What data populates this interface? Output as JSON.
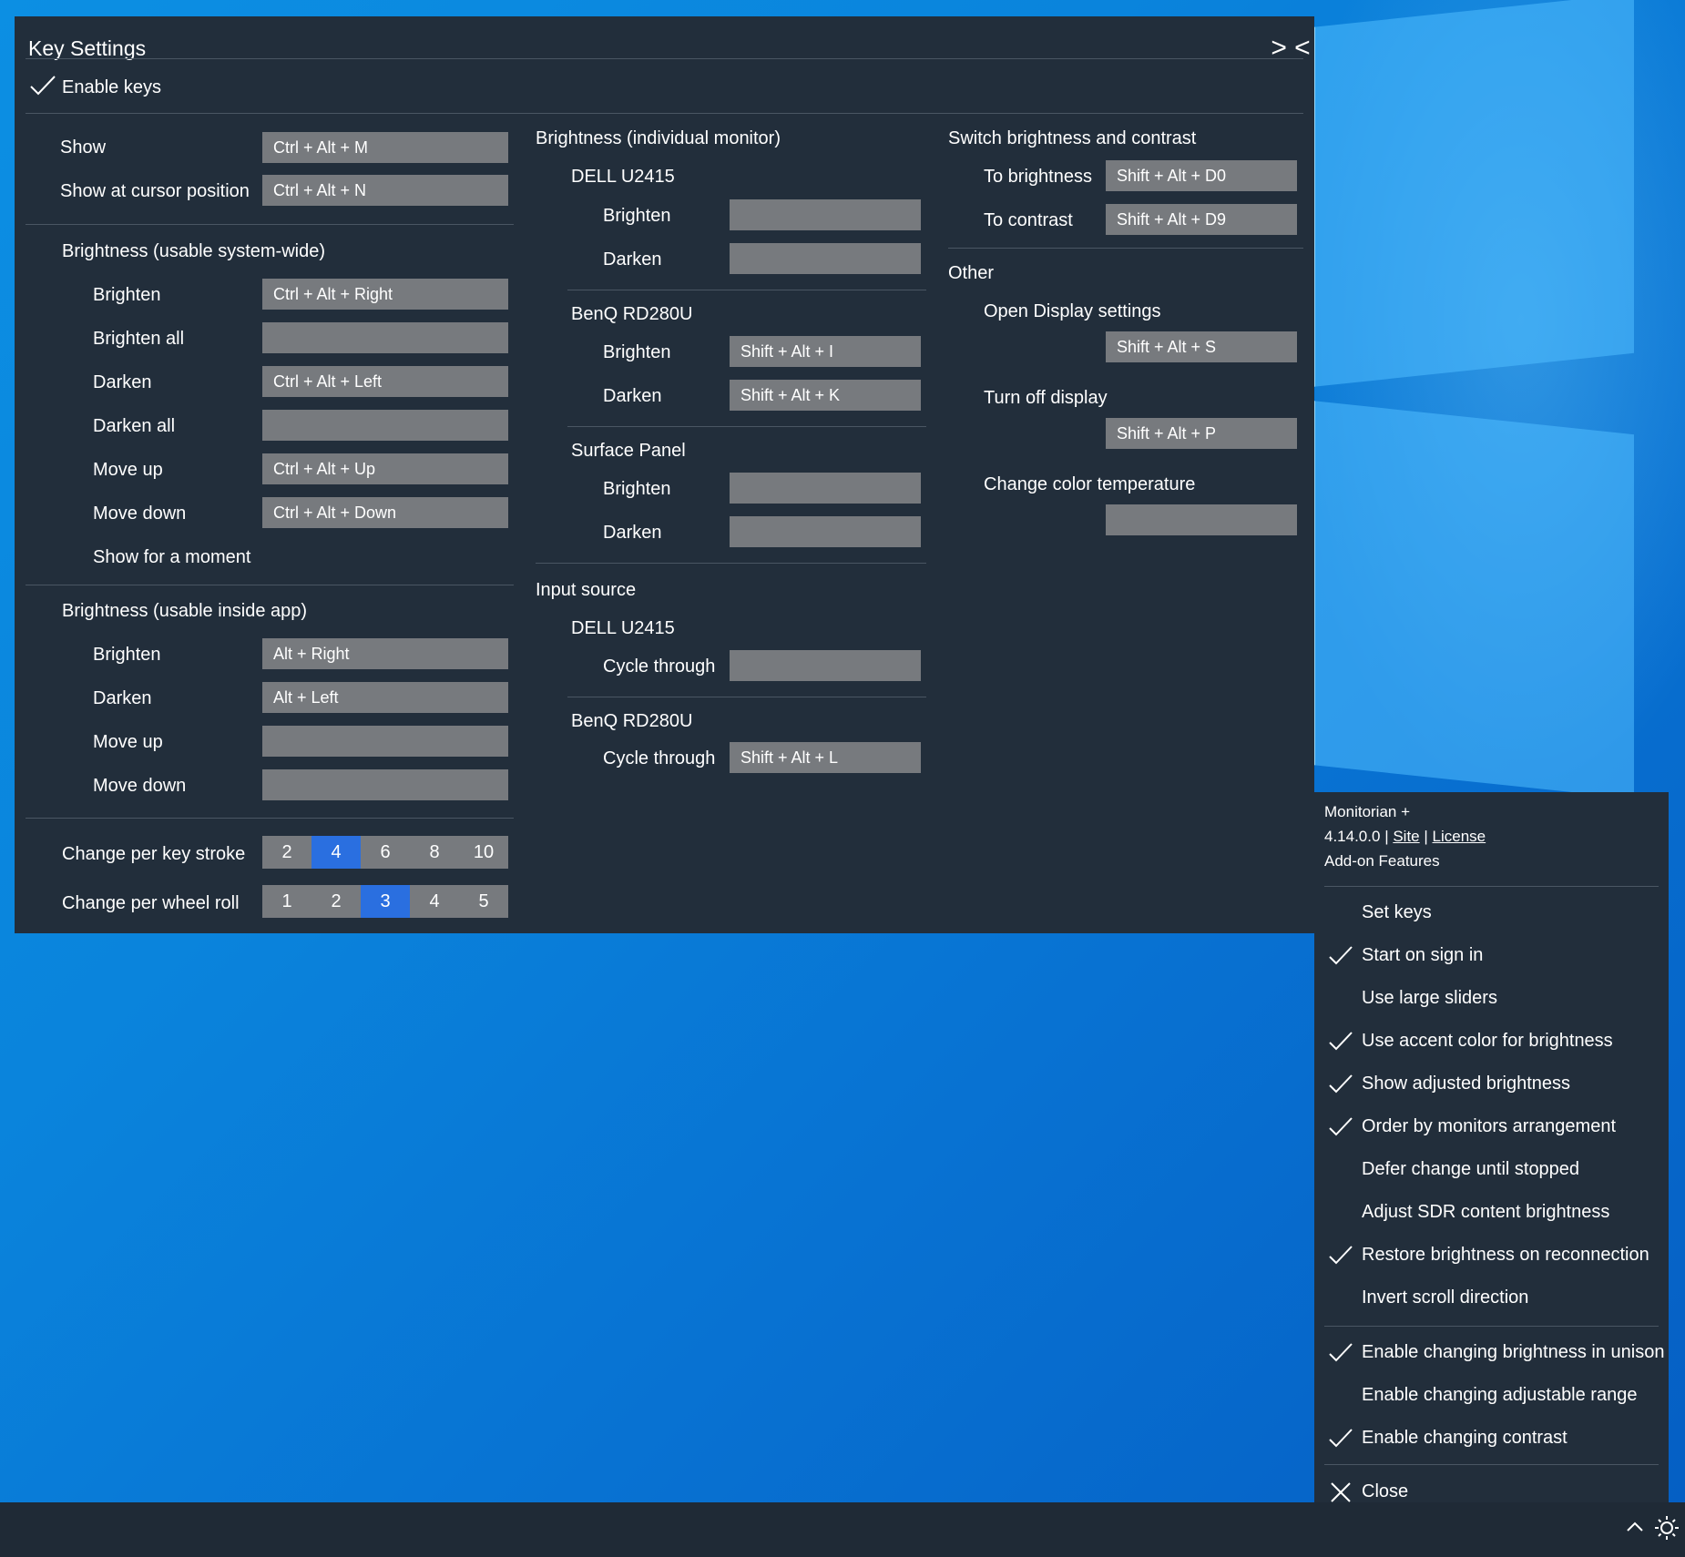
{
  "key_settings": {
    "title": "Key Settings",
    "toggle_glyph": "> <",
    "enable_keys": {
      "label": "Enable keys",
      "checked": true
    },
    "col1": {
      "show": {
        "label": "Show",
        "value": "Ctrl + Alt + M"
      },
      "show_cursor": {
        "label": "Show at cursor position",
        "value": "Ctrl + Alt + N"
      },
      "system_wide": {
        "heading": "Brightness (usable system-wide)",
        "rows": [
          {
            "label": "Brighten",
            "value": "Ctrl + Alt + Right"
          },
          {
            "label": "Brighten all",
            "value": ""
          },
          {
            "label": "Darken",
            "value": "Ctrl + Alt + Left"
          },
          {
            "label": "Darken all",
            "value": ""
          },
          {
            "label": "Move up",
            "value": "Ctrl + Alt + Up"
          },
          {
            "label": "Move down",
            "value": "Ctrl + Alt + Down"
          }
        ],
        "show_moment": "Show for a moment"
      },
      "inside_app": {
        "heading": "Brightness (usable inside app)",
        "rows": [
          {
            "label": "Brighten",
            "value": "Alt + Right"
          },
          {
            "label": "Darken",
            "value": "Alt + Left"
          },
          {
            "label": "Move up",
            "value": ""
          },
          {
            "label": "Move down",
            "value": ""
          }
        ]
      },
      "key_stroke": {
        "label": "Change per key stroke",
        "options": [
          "2",
          "4",
          "6",
          "8",
          "10"
        ],
        "selected": "4"
      },
      "wheel_roll": {
        "label": "Change per wheel roll",
        "options": [
          "1",
          "2",
          "3",
          "4",
          "5"
        ],
        "selected": "3"
      }
    },
    "col2": {
      "individual": {
        "heading": "Brightness (individual monitor)",
        "monitors": [
          {
            "name": "DELL U2415",
            "brighten_label": "Brighten",
            "brighten": "",
            "darken_label": "Darken",
            "darken": ""
          },
          {
            "name": "BenQ RD280U",
            "brighten_label": "Brighten",
            "brighten": "Shift + Alt + I",
            "darken_label": "Darken",
            "darken": "Shift + Alt + K"
          },
          {
            "name": "Surface Panel",
            "brighten_label": "Brighten",
            "brighten": "",
            "darken_label": "Darken",
            "darken": ""
          }
        ]
      },
      "input_source": {
        "heading": "Input source",
        "monitors": [
          {
            "name": "DELL U2415",
            "cycle_label": "Cycle through",
            "cycle": ""
          },
          {
            "name": "BenQ RD280U",
            "cycle_label": "Cycle through",
            "cycle": "Shift + Alt + L"
          }
        ]
      }
    },
    "col3": {
      "switch": {
        "heading": "Switch brightness and contrast",
        "to_brightness": {
          "label": "To brightness",
          "value": "Shift + Alt + D0"
        },
        "to_contrast": {
          "label": "To contrast",
          "value": "Shift + Alt + D9"
        }
      },
      "other": {
        "heading": "Other",
        "open_display": {
          "label": "Open Display settings",
          "value": "Shift + Alt + S"
        },
        "turn_off": {
          "label": "Turn off display",
          "value": "Shift + Alt + P"
        },
        "color_temp": {
          "label": "Change color temperature",
          "value": ""
        }
      }
    }
  },
  "context_menu": {
    "app_name": "Monitorian +",
    "version": "4.14.0.0",
    "sep": "|",
    "site": "Site",
    "license": "License",
    "addon": "Add-on Features",
    "items": [
      {
        "label": "Set keys",
        "checked": false
      },
      {
        "label": "Start on sign in",
        "checked": true
      },
      {
        "label": "Use large sliders",
        "checked": false
      },
      {
        "label": "Use accent color for brightness",
        "checked": true
      },
      {
        "label": "Show adjusted brightness",
        "checked": true
      },
      {
        "label": "Order by monitors arrangement",
        "checked": true
      },
      {
        "label": "Defer change until stopped",
        "checked": false
      },
      {
        "label": "Adjust SDR content brightness",
        "checked": false
      },
      {
        "label": "Restore brightness on reconnection",
        "checked": true
      },
      {
        "label": "Invert scroll direction",
        "checked": false
      }
    ],
    "addon_items": [
      {
        "label": "Enable changing brightness in unison",
        "checked": true
      },
      {
        "label": "Enable changing adjustable range",
        "checked": false
      },
      {
        "label": "Enable changing contrast",
        "checked": true
      }
    ],
    "close": "Close"
  },
  "taskbar": {
    "tray_chevron": "^"
  },
  "colors": {
    "panel": "#222e3b",
    "field": "#777a7e",
    "accent": "#2a6fe0",
    "desktop": "#0a84dc",
    "taskbar": "#1f2a36"
  }
}
